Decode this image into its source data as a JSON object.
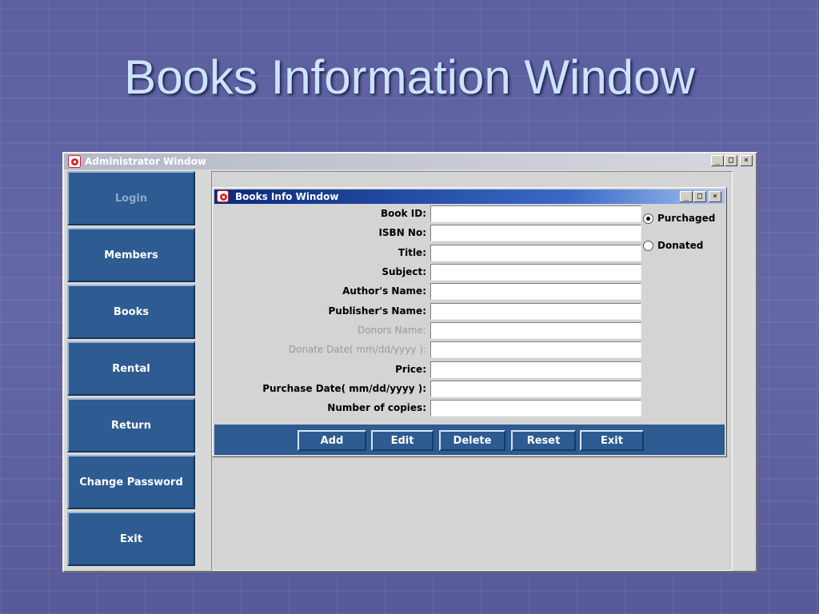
{
  "slide": {
    "title": "Books Information Window"
  },
  "admin_window": {
    "title": "Administrator Window",
    "controls": {
      "minimize": "_",
      "maximize": "□",
      "close": "×"
    },
    "sidebar": {
      "items": [
        {
          "label": "Login",
          "enabled": false
        },
        {
          "label": "Members",
          "enabled": true
        },
        {
          "label": "Books",
          "enabled": true
        },
        {
          "label": "Rental",
          "enabled": true
        },
        {
          "label": "Return",
          "enabled": true
        },
        {
          "label": "Change Password",
          "enabled": true
        },
        {
          "label": "Exit",
          "enabled": true
        }
      ]
    }
  },
  "books_window": {
    "title": "Books Info Window",
    "controls": {
      "minimize": "_",
      "maximize": "□",
      "close": "×"
    },
    "fields": [
      {
        "label": "Book ID:",
        "value": "",
        "enabled": true
      },
      {
        "label": "ISBN No:",
        "value": "",
        "enabled": true
      },
      {
        "label": "Title:",
        "value": "",
        "enabled": true
      },
      {
        "label": "Subject:",
        "value": "",
        "enabled": true
      },
      {
        "label": "Author's Name:",
        "value": "",
        "enabled": true
      },
      {
        "label": "Publisher's Name:",
        "value": "",
        "enabled": true
      },
      {
        "label": "Donors Name:",
        "value": "",
        "enabled": false
      },
      {
        "label": "Donate Date( mm/dd/yyyy ):",
        "value": "",
        "enabled": false
      },
      {
        "label": "Price:",
        "value": "",
        "enabled": true
      },
      {
        "label": "Purchase Date( mm/dd/yyyy ):",
        "value": "",
        "enabled": true
      },
      {
        "label": "Number of copies:",
        "value": "",
        "enabled": true
      }
    ],
    "acquisition": {
      "options": [
        {
          "label": "Purchaged",
          "selected": true
        },
        {
          "label": "Donated",
          "selected": false
        }
      ]
    },
    "actions": {
      "add": "Add",
      "edit": "Edit",
      "delete": "Delete",
      "reset": "Reset",
      "exit": "Exit"
    }
  }
}
